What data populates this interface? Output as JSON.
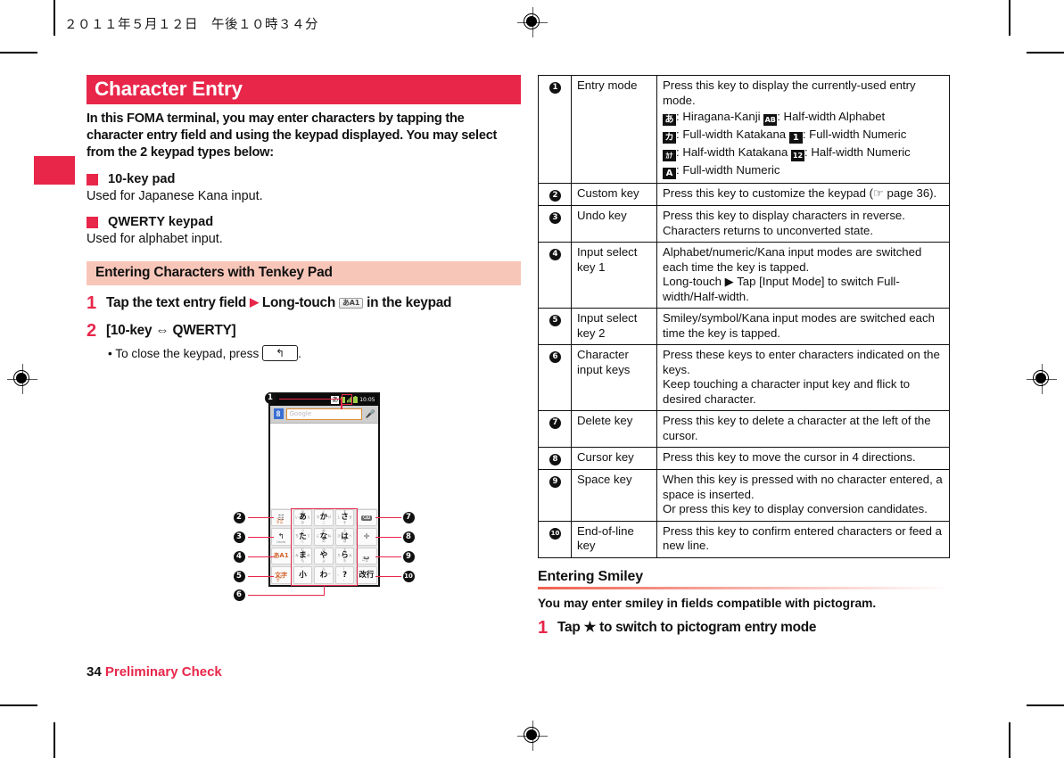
{
  "page": {
    "running_head": "２０１１年５月１２日　午後１０時３４分",
    "folio_number": "34",
    "folio_section": "Preliminary Check",
    "accent_red": "#e8264a",
    "heading_band_pink": "#f8c6b9"
  },
  "left": {
    "h1": "Character Entry",
    "lead": "In this FOMA terminal, you may enter characters by tapping the character entry field and using the keypad displayed. You may select from the 2 keypad types below:",
    "bullets": [
      {
        "title": "10-key pad",
        "note": "Used for Japanese Kana input."
      },
      {
        "title": "QWERTY keypad",
        "note": "Used for alphabet input."
      }
    ],
    "h2": "Entering Characters with Tenkey Pad",
    "steps": [
      {
        "num": "1",
        "pre": "Tap the text entry field",
        "arrow": "▶",
        "mid": "Long-touch",
        "keycap": "あA1",
        "post": "in the keypad"
      },
      {
        "num": "2",
        "text": "[10-key ⇔ QWERTY]",
        "substep_pre": "• To close the keypad, press",
        "substep_key": "↰",
        "substep_post": "."
      }
    ]
  },
  "figure": {
    "status_bar": {
      "ime_glyph": "あ",
      "clock": "10:05"
    },
    "search_bar": {
      "logo": "8",
      "placeholder": "Google",
      "mic_icon": "mic-icon"
    },
    "keypad": {
      "left_keys": [
        {
          "top": "記号",
          "bottom": "カスタム",
          "name": "custom-key"
        },
        {
          "top": "↰",
          "bottom": "Undo",
          "name": "undo-key"
        },
        {
          "top": "あA1",
          "bottom": "",
          "name": "input-select-key-1"
        },
        {
          "top": "文字",
          "bottom": "絵文字",
          "name": "input-select-key-2"
        }
      ],
      "center_keys": [
        {
          "center": "あ",
          "n": "う",
          "w": "い",
          "e": "え",
          "s": "お"
        },
        {
          "center": "か",
          "n": "く",
          "w": "き",
          "e": "け",
          "s": "こ"
        },
        {
          "center": "さ",
          "n": "す",
          "w": "し",
          "e": "せ",
          "s": "そ"
        },
        {
          "center": "た",
          "n": "つ",
          "w": "ち",
          "e": "て",
          "s": "と"
        },
        {
          "center": "な",
          "n": "ぬ",
          "w": "に",
          "e": "ね",
          "s": "の"
        },
        {
          "center": "は",
          "n": "ふ",
          "w": "ひ",
          "e": "へ",
          "s": "ほ"
        },
        {
          "center": "ま",
          "n": "む",
          "w": "み",
          "e": "め",
          "s": "も"
        },
        {
          "center": "や",
          "n": "ゆ",
          "w": "",
          "e": "",
          "s": "よ"
        },
        {
          "center": "ら",
          "n": "る",
          "w": "り",
          "e": "れ",
          "s": "ろ"
        },
        {
          "center": "小",
          "n": "゛",
          "w": "",
          "e": "゜",
          "s": ""
        },
        {
          "center": "わ",
          "n": "ん",
          "w": "",
          "e": "ー",
          "s": ""
        },
        {
          "center": "?",
          "n": "！",
          "w": "。",
          "e": "",
          "s": "、"
        }
      ],
      "right_keys": [
        {
          "label": "⌫",
          "sub": "",
          "name": "delete-key"
        },
        {
          "label": "✛",
          "sub": "",
          "name": "cursor-key"
        },
        {
          "label": "␣",
          "sub": "スペース",
          "name": "space-key"
        },
        {
          "label": "改行",
          "sub": "",
          "name": "end-of-line-key"
        }
      ]
    },
    "callouts": [
      "❶",
      "❷",
      "❸",
      "❹",
      "❺",
      "❻",
      "❼",
      "❽",
      "❾",
      "❿"
    ]
  },
  "table": {
    "rows": [
      {
        "num": "1",
        "name": "Entry mode",
        "desc_lines": [
          "Press this key to display the currently-used entry mode."
        ],
        "glyph_lines": [
          [
            {
              "glyph": "あ",
              "text": ": Hiragana-Kanji"
            },
            {
              "glyph": "AB",
              "text": ": Half-width Alphabet"
            }
          ],
          [
            {
              "glyph": "カ",
              "text": ": Full-width Katakana"
            },
            {
              "glyph": "1",
              "text": ": Full-width Numeric"
            }
          ],
          [
            {
              "glyph": "ｶﾅ",
              "text": ": Half-width Katakana"
            },
            {
              "glyph": "12",
              "text": ": Half-width Numeric"
            }
          ],
          [
            {
              "glyph": "A",
              "text": ": Full-width Numeric"
            }
          ]
        ]
      },
      {
        "num": "2",
        "name": "Custom key",
        "desc_lines": [
          "Press this key to customize the keypad (☞ page 36)."
        ],
        "glyph_lines": []
      },
      {
        "num": "3",
        "name": "Undo key",
        "desc_lines": [
          "Press this key to display characters in reverse.",
          "Characters returns to unconverted state."
        ],
        "glyph_lines": []
      },
      {
        "num": "4",
        "name": "Input select key 1",
        "desc_lines": [
          "Alphabet/numeric/Kana input modes are switched each time the key is tapped.",
          "Long-touch ▶ Tap [Input Mode] to switch Full-width/Half-width."
        ],
        "glyph_lines": []
      },
      {
        "num": "5",
        "name": "Input select key 2",
        "desc_lines": [
          "Smiley/symbol/Kana input modes are switched each time the key is tapped."
        ],
        "glyph_lines": []
      },
      {
        "num": "6",
        "name": "Character input keys",
        "desc_lines": [
          "Press these keys to enter characters indicated on the keys.",
          "Keep touching a character input key and flick to desired character."
        ],
        "glyph_lines": []
      },
      {
        "num": "7",
        "name": "Delete key",
        "desc_lines": [
          "Press this key to delete a character at the left of the cursor."
        ],
        "glyph_lines": []
      },
      {
        "num": "8",
        "name": "Cursor key",
        "desc_lines": [
          "Press this key to move the cursor in 4 directions."
        ],
        "glyph_lines": []
      },
      {
        "num": "9",
        "name": "Space key",
        "desc_lines": [
          "When this key is pressed with no character entered, a space is inserted.",
          "Or press this key to display conversion candidates."
        ],
        "glyph_lines": []
      },
      {
        "num": "10",
        "name": "End-of-line key",
        "desc_lines": [
          "Press this key to confirm entered characters or feed a new line."
        ],
        "glyph_lines": []
      }
    ]
  },
  "right_bottom": {
    "h3": "Entering Smiley",
    "note": "You may enter smiley in fields compatible with pictogram.",
    "step_num": "1",
    "step_text": "Tap ★ to switch to pictogram entry mode"
  }
}
